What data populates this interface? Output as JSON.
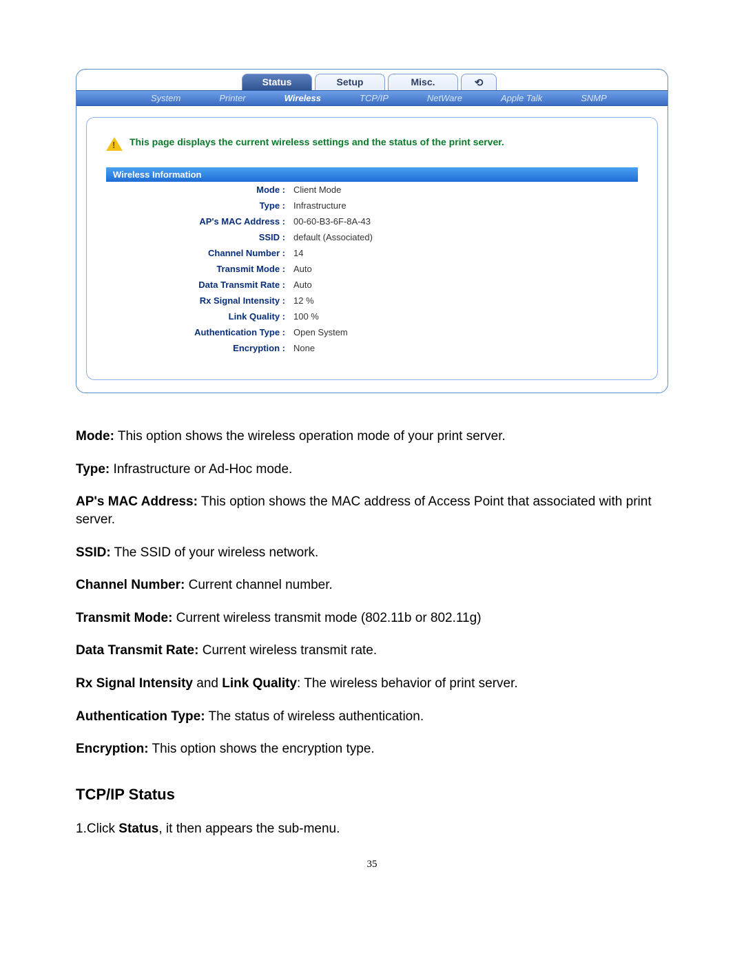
{
  "tabs": {
    "status": "Status",
    "setup": "Setup",
    "misc": "Misc.",
    "reboot": "⟲"
  },
  "subtabs": {
    "system": "System",
    "printer": "Printer",
    "wireless": "Wireless",
    "tcpip": "TCP/IP",
    "netware": "NetWare",
    "appletalk": "Apple Talk",
    "snmp": "SNMP"
  },
  "intro": "This page displays the current wireless settings and the status of the print server.",
  "section_title": "Wireless Information",
  "fields": {
    "mode": {
      "label": "Mode :",
      "value": "Client Mode"
    },
    "type": {
      "label": "Type :",
      "value": "Infrastructure"
    },
    "ap_mac": {
      "label": "AP's MAC Address :",
      "value": "00-60-B3-6F-8A-43"
    },
    "ssid": {
      "label": "SSID :",
      "value": "default (Associated)"
    },
    "channel": {
      "label": "Channel Number :",
      "value": "14"
    },
    "tx_mode": {
      "label": "Transmit Mode :",
      "value": "Auto"
    },
    "tx_rate": {
      "label": "Data Transmit Rate :",
      "value": "Auto"
    },
    "rx_signal": {
      "label": "Rx Signal Intensity :",
      "value": "12 %"
    },
    "link_quality": {
      "label": "Link Quality :",
      "value": "100 %"
    },
    "auth_type": {
      "label": "Authentication Type :",
      "value": "Open System"
    },
    "encryption": {
      "label": "Encryption :",
      "value": "None"
    }
  },
  "doc": {
    "p1_b": "Mode:",
    "p1": " This option shows the wireless operation mode of your print server.",
    "p2_b": "Type:",
    "p2": " Infrastructure or Ad-Hoc mode.",
    "p3_b": "AP's MAC Address:",
    "p3": " This option shows the MAC address of Access Point that associated with print server.",
    "p4_b": "SSID:",
    "p4": " The SSID of your wireless network.",
    "p5_b": "Channel Number:",
    "p5": " Current channel number.",
    "p6_b": "Transmit Mode:",
    "p6": " Current wireless transmit mode (802.11b or 802.11g)",
    "p7_b": "Data Transmit Rate:",
    "p7": " Current wireless transmit rate.",
    "p8_b1": "Rx Signal Intensity",
    "p8_mid": " and ",
    "p8_b2": "Link Quality",
    "p8": ": The wireless behavior of print server.",
    "p9_b": "Authentication Type:",
    "p9": " The status of wireless authentication.",
    "p10_b": "Encryption:",
    "p10": " This option shows the encryption type.",
    "h2": "TCP/IP Status",
    "step1_pre": "1.Click ",
    "step1_b": "Status",
    "step1_post": ", it then appears the sub-menu."
  },
  "page_number": "35"
}
